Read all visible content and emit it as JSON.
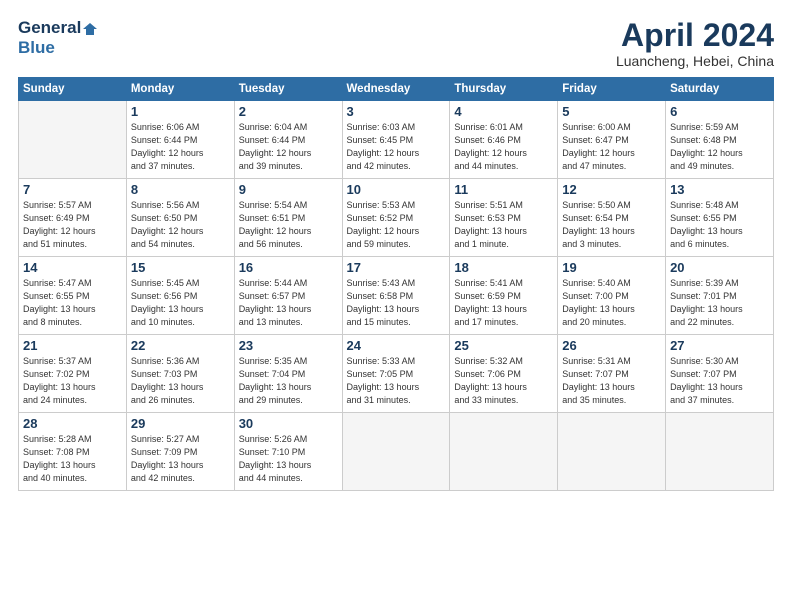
{
  "logo": {
    "line1": "General",
    "line2": "Blue"
  },
  "title": "April 2024",
  "subtitle": "Luancheng, Hebei, China",
  "headers": [
    "Sunday",
    "Monday",
    "Tuesday",
    "Wednesday",
    "Thursday",
    "Friday",
    "Saturday"
  ],
  "weeks": [
    [
      {
        "num": "",
        "info": ""
      },
      {
        "num": "1",
        "info": "Sunrise: 6:06 AM\nSunset: 6:44 PM\nDaylight: 12 hours\nand 37 minutes."
      },
      {
        "num": "2",
        "info": "Sunrise: 6:04 AM\nSunset: 6:44 PM\nDaylight: 12 hours\nand 39 minutes."
      },
      {
        "num": "3",
        "info": "Sunrise: 6:03 AM\nSunset: 6:45 PM\nDaylight: 12 hours\nand 42 minutes."
      },
      {
        "num": "4",
        "info": "Sunrise: 6:01 AM\nSunset: 6:46 PM\nDaylight: 12 hours\nand 44 minutes."
      },
      {
        "num": "5",
        "info": "Sunrise: 6:00 AM\nSunset: 6:47 PM\nDaylight: 12 hours\nand 47 minutes."
      },
      {
        "num": "6",
        "info": "Sunrise: 5:59 AM\nSunset: 6:48 PM\nDaylight: 12 hours\nand 49 minutes."
      }
    ],
    [
      {
        "num": "7",
        "info": "Sunrise: 5:57 AM\nSunset: 6:49 PM\nDaylight: 12 hours\nand 51 minutes."
      },
      {
        "num": "8",
        "info": "Sunrise: 5:56 AM\nSunset: 6:50 PM\nDaylight: 12 hours\nand 54 minutes."
      },
      {
        "num": "9",
        "info": "Sunrise: 5:54 AM\nSunset: 6:51 PM\nDaylight: 12 hours\nand 56 minutes."
      },
      {
        "num": "10",
        "info": "Sunrise: 5:53 AM\nSunset: 6:52 PM\nDaylight: 12 hours\nand 59 minutes."
      },
      {
        "num": "11",
        "info": "Sunrise: 5:51 AM\nSunset: 6:53 PM\nDaylight: 13 hours\nand 1 minute."
      },
      {
        "num": "12",
        "info": "Sunrise: 5:50 AM\nSunset: 6:54 PM\nDaylight: 13 hours\nand 3 minutes."
      },
      {
        "num": "13",
        "info": "Sunrise: 5:48 AM\nSunset: 6:55 PM\nDaylight: 13 hours\nand 6 minutes."
      }
    ],
    [
      {
        "num": "14",
        "info": "Sunrise: 5:47 AM\nSunset: 6:55 PM\nDaylight: 13 hours\nand 8 minutes."
      },
      {
        "num": "15",
        "info": "Sunrise: 5:45 AM\nSunset: 6:56 PM\nDaylight: 13 hours\nand 10 minutes."
      },
      {
        "num": "16",
        "info": "Sunrise: 5:44 AM\nSunset: 6:57 PM\nDaylight: 13 hours\nand 13 minutes."
      },
      {
        "num": "17",
        "info": "Sunrise: 5:43 AM\nSunset: 6:58 PM\nDaylight: 13 hours\nand 15 minutes."
      },
      {
        "num": "18",
        "info": "Sunrise: 5:41 AM\nSunset: 6:59 PM\nDaylight: 13 hours\nand 17 minutes."
      },
      {
        "num": "19",
        "info": "Sunrise: 5:40 AM\nSunset: 7:00 PM\nDaylight: 13 hours\nand 20 minutes."
      },
      {
        "num": "20",
        "info": "Sunrise: 5:39 AM\nSunset: 7:01 PM\nDaylight: 13 hours\nand 22 minutes."
      }
    ],
    [
      {
        "num": "21",
        "info": "Sunrise: 5:37 AM\nSunset: 7:02 PM\nDaylight: 13 hours\nand 24 minutes."
      },
      {
        "num": "22",
        "info": "Sunrise: 5:36 AM\nSunset: 7:03 PM\nDaylight: 13 hours\nand 26 minutes."
      },
      {
        "num": "23",
        "info": "Sunrise: 5:35 AM\nSunset: 7:04 PM\nDaylight: 13 hours\nand 29 minutes."
      },
      {
        "num": "24",
        "info": "Sunrise: 5:33 AM\nSunset: 7:05 PM\nDaylight: 13 hours\nand 31 minutes."
      },
      {
        "num": "25",
        "info": "Sunrise: 5:32 AM\nSunset: 7:06 PM\nDaylight: 13 hours\nand 33 minutes."
      },
      {
        "num": "26",
        "info": "Sunrise: 5:31 AM\nSunset: 7:07 PM\nDaylight: 13 hours\nand 35 minutes."
      },
      {
        "num": "27",
        "info": "Sunrise: 5:30 AM\nSunset: 7:07 PM\nDaylight: 13 hours\nand 37 minutes."
      }
    ],
    [
      {
        "num": "28",
        "info": "Sunrise: 5:28 AM\nSunset: 7:08 PM\nDaylight: 13 hours\nand 40 minutes."
      },
      {
        "num": "29",
        "info": "Sunrise: 5:27 AM\nSunset: 7:09 PM\nDaylight: 13 hours\nand 42 minutes."
      },
      {
        "num": "30",
        "info": "Sunrise: 5:26 AM\nSunset: 7:10 PM\nDaylight: 13 hours\nand 44 minutes."
      },
      {
        "num": "",
        "info": ""
      },
      {
        "num": "",
        "info": ""
      },
      {
        "num": "",
        "info": ""
      },
      {
        "num": "",
        "info": ""
      }
    ]
  ]
}
